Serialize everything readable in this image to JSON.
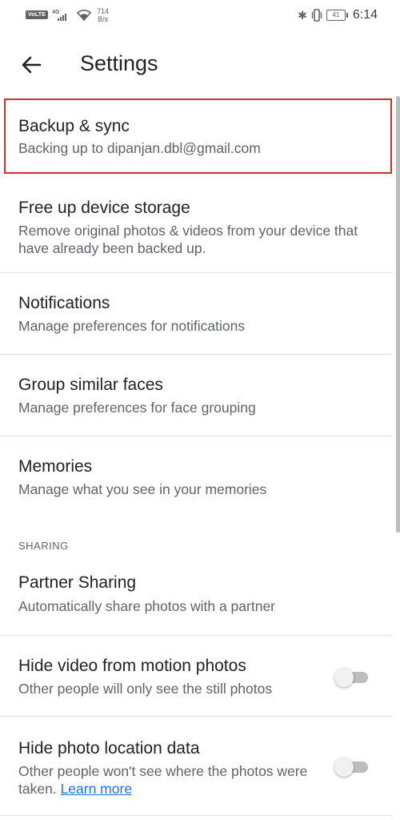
{
  "status_bar": {
    "carrier_badge": "VoLTE",
    "network": "4G",
    "speed_value": "714",
    "speed_unit": "B/s",
    "battery": "41",
    "time": "6:14"
  },
  "app_bar": {
    "title": "Settings"
  },
  "items": [
    {
      "title": "Backup & sync",
      "subtitle": "Backing up to dipanjan.dbl@gmail.com"
    },
    {
      "title": "Free up device storage",
      "subtitle": "Remove original photos & videos from your device that have already been backed up."
    },
    {
      "title": "Notifications",
      "subtitle": "Manage preferences for notifications"
    },
    {
      "title": "Group similar faces",
      "subtitle": "Manage preferences for face grouping"
    },
    {
      "title": "Memories",
      "subtitle": "Manage what you see in your memories"
    },
    {
      "title": "Partner Sharing",
      "subtitle": "Automatically share photos with a partner"
    },
    {
      "title": "Hide video from motion photos",
      "subtitle": "Other people will only see the still photos",
      "toggle": false
    },
    {
      "title": "Hide photo location data",
      "subtitle": "Other people won't see where the photos were taken.",
      "link": "Learn more",
      "toggle": false
    }
  ],
  "sections": {
    "sharing": "SHARING"
  },
  "colors": {
    "highlight_border": "#d0312d",
    "link": "#1a73e8"
  }
}
